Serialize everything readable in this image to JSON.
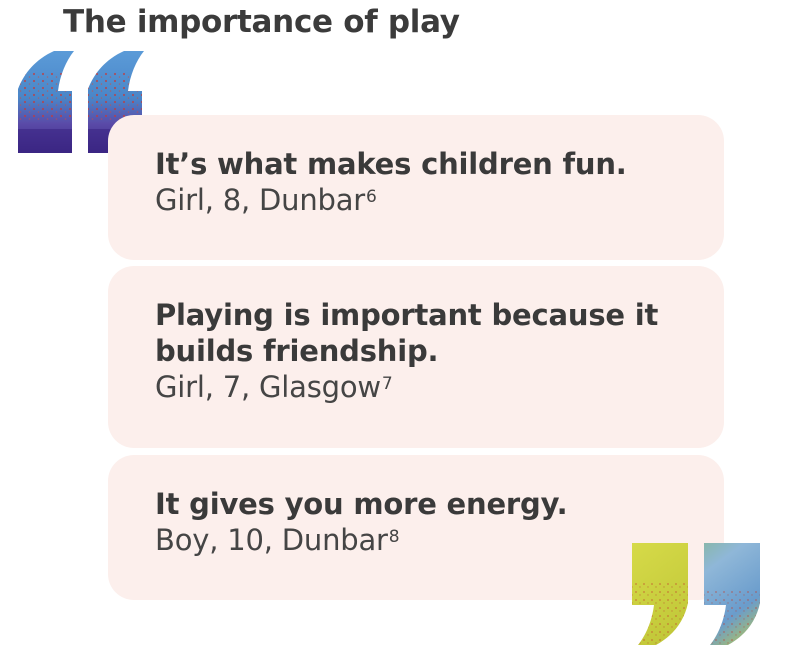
{
  "page": {
    "title": "The importance of play"
  },
  "quotes": [
    {
      "text": "It’s what makes children fun.",
      "attribution": "Girl, 8, Dunbar",
      "footnote": "6"
    },
    {
      "text": "Playing is important because it builds friendship.",
      "attribution": "Girl, 7, Glasgow",
      "footnote": "7"
    },
    {
      "text": "It gives you more energy.",
      "attribution": "Boy, 10, Dunbar",
      "footnote": "8"
    }
  ],
  "colors": {
    "card_background": "#fcefec",
    "text": "#3a3a3a",
    "open_quote_blue": "#4a86c8",
    "open_quote_purple": "#4b2e8f",
    "close_quote_yellow": "#c8d23a",
    "close_quote_green": "#6aa84f"
  },
  "icons": {
    "open_quote": "open-quotation-mark-icon",
    "close_quote": "close-quotation-mark-icon"
  }
}
